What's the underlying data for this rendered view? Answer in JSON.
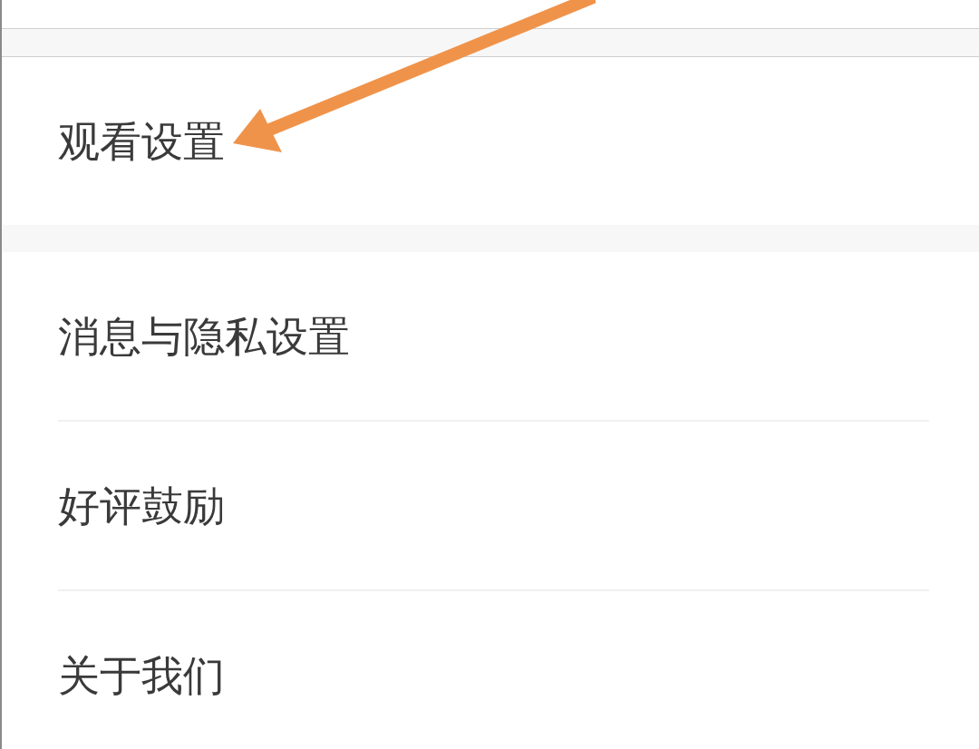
{
  "sections": [
    {
      "items": [
        {
          "label": "观看设置"
        }
      ]
    },
    {
      "items": [
        {
          "label": "消息与隐私设置"
        },
        {
          "label": "好评鼓励"
        },
        {
          "label": "关于我们"
        }
      ]
    }
  ]
}
